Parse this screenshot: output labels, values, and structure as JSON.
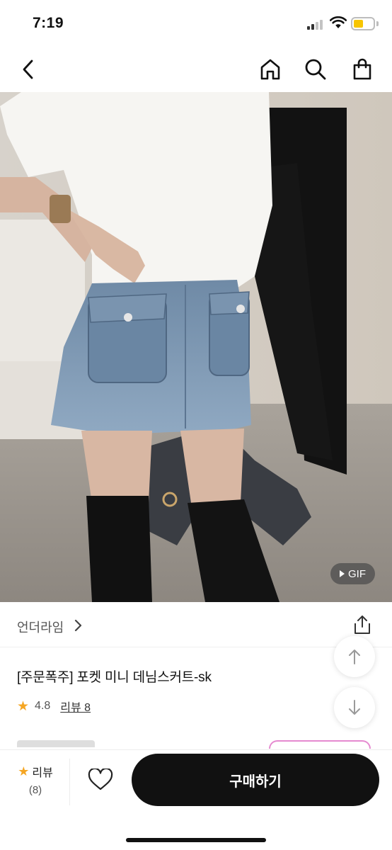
{
  "status_bar": {
    "time": "7:19",
    "battery_level": 0.35
  },
  "nav": {
    "icons": [
      "back-icon",
      "home-icon",
      "search-icon",
      "shopping-bag-icon"
    ]
  },
  "product_image": {
    "badge": "GIF"
  },
  "brand": {
    "name": "언더라임"
  },
  "product": {
    "title": "[주문폭주] 포켓 미니 데님스커트-sk",
    "rating": "4.8",
    "review_link": "리뷰 8"
  },
  "bottom_bar": {
    "review_label": "리뷰",
    "review_count": "(8)",
    "buy_label": "구매하기"
  },
  "colors": {
    "accent_star": "#f5a623",
    "buy_button": "#111111",
    "gif_badge": "#505050"
  }
}
